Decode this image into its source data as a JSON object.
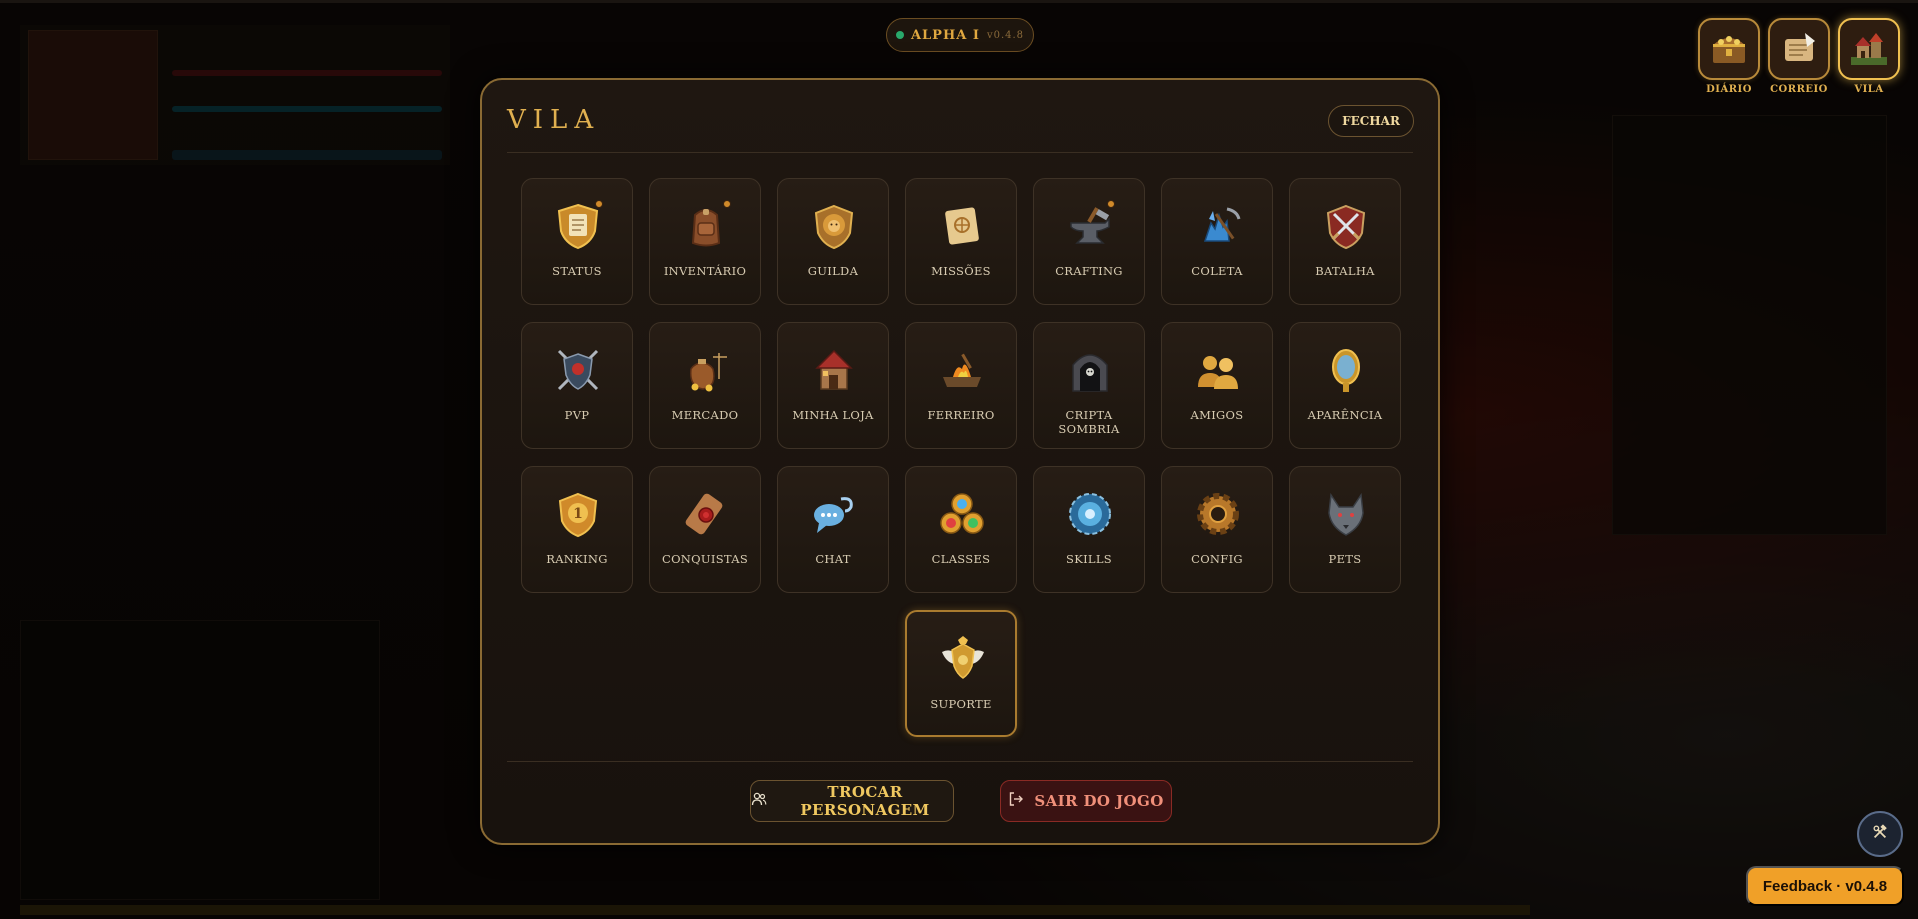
{
  "header": {
    "alpha_label": "ALPHA I",
    "alpha_version": "v0.4.8"
  },
  "quick_nav": [
    {
      "label": "DIÁRIO",
      "icon": "treasure-chest-icon"
    },
    {
      "label": "CORREIO",
      "icon": "scroll-quill-icon"
    },
    {
      "label": "VILA",
      "icon": "village-icon",
      "active": true
    }
  ],
  "modal": {
    "title": "VILA",
    "close_label": "FECHAR",
    "tiles": [
      {
        "label": "STATUS",
        "icon": "status-scroll-shield-icon",
        "notification": true
      },
      {
        "label": "INVENTÁRIO",
        "icon": "backpack-icon",
        "notification": true
      },
      {
        "label": "GUILDA",
        "icon": "lion-crest-icon"
      },
      {
        "label": "MISSÕES",
        "icon": "quest-scroll-icon"
      },
      {
        "label": "CRAFTING",
        "icon": "anvil-icon",
        "notification": true
      },
      {
        "label": "COLETA",
        "icon": "pickaxe-crystal-icon"
      },
      {
        "label": "BATALHA",
        "icon": "crossed-swords-icon"
      },
      {
        "label": "PVP",
        "icon": "skull-shield-icon"
      },
      {
        "label": "MERCADO",
        "icon": "coin-bag-scale-icon"
      },
      {
        "label": "MINHA LOJA",
        "icon": "shop-house-icon"
      },
      {
        "label": "FERREIRO",
        "icon": "forge-icon"
      },
      {
        "label": "CRIPTA SOMBRIA",
        "icon": "crypt-icon"
      },
      {
        "label": "AMIGOS",
        "icon": "friends-icon"
      },
      {
        "label": "APARÊNCIA",
        "icon": "mirror-icon"
      },
      {
        "label": "RANKING",
        "icon": "rank-medal-icon"
      },
      {
        "label": "CONQUISTAS",
        "icon": "wax-seal-scroll-icon"
      },
      {
        "label": "CHAT",
        "icon": "chat-bubbles-icon"
      },
      {
        "label": "CLASSES",
        "icon": "class-orbs-icon"
      },
      {
        "label": "SKILLS",
        "icon": "skill-gear-icon"
      },
      {
        "label": "CONFIG",
        "icon": "settings-gear-icon"
      },
      {
        "label": "PETS",
        "icon": "wolf-icon"
      },
      {
        "label": "SUPORTE",
        "icon": "winged-crest-icon",
        "highlight": true
      }
    ],
    "switch_character_label": "TROCAR PERSONAGEM",
    "exit_game_label": "SAIR DO JOGO"
  },
  "feedback_label": "Feedback · v0.4.8",
  "colors": {
    "accent_gold": "#e0b050",
    "modal_border": "#8a6a33",
    "exit_red": "#3a1212",
    "feedback_orange": "#f0a028"
  }
}
